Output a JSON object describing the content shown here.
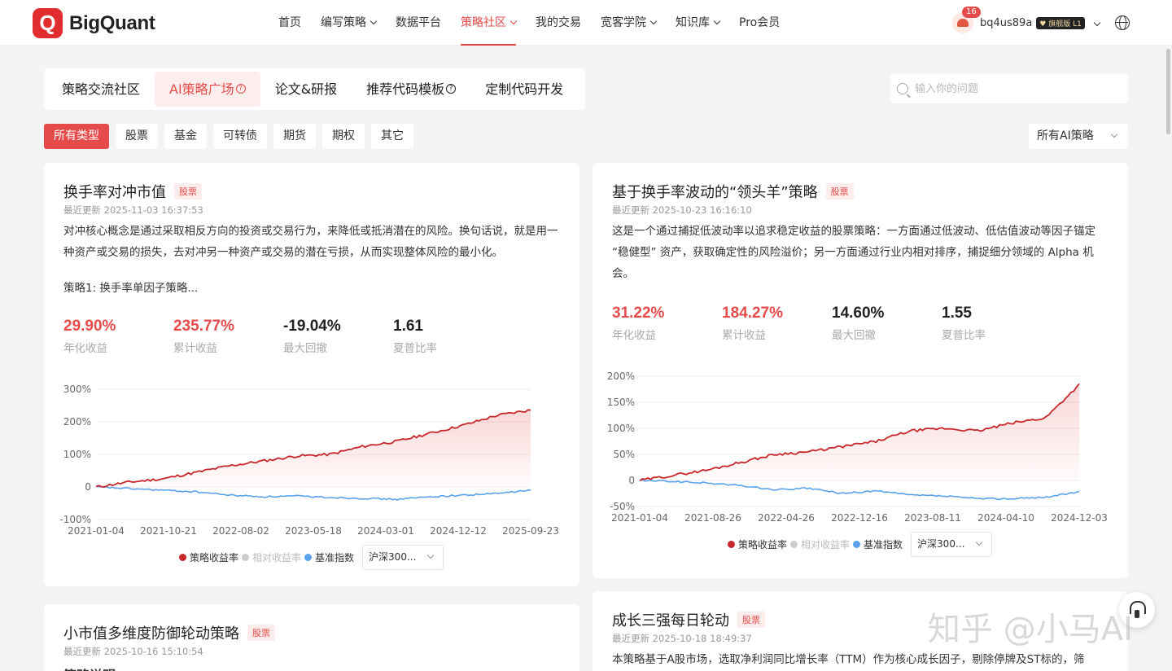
{
  "header": {
    "logo_text": "BigQuant",
    "logo_mark": "Q",
    "nav": [
      {
        "label": "首页",
        "dropdown": false,
        "active": false
      },
      {
        "label": "编写策略",
        "dropdown": true,
        "active": false
      },
      {
        "label": "数据平台",
        "dropdown": false,
        "active": false
      },
      {
        "label": "策略社区",
        "dropdown": true,
        "active": true
      },
      {
        "label": "我的交易",
        "dropdown": false,
        "active": false
      },
      {
        "label": "宽客学院",
        "dropdown": true,
        "active": false
      },
      {
        "label": "知识库",
        "dropdown": true,
        "active": false
      },
      {
        "label": "Pro会员",
        "dropdown": false,
        "active": false
      }
    ],
    "notification_count": "16",
    "username": "bq4us89a",
    "tier_badge": "旗舰版 L1",
    "language_icon": "globe-icon"
  },
  "subtabs": [
    {
      "label": "策略交流社区",
      "active": false,
      "help": false
    },
    {
      "label": "AI策略广场",
      "active": true,
      "help": true
    },
    {
      "label": "论文&研报",
      "active": false,
      "help": false
    },
    {
      "label": "推荐代码模板",
      "active": false,
      "help": true
    },
    {
      "label": "定制代码开发",
      "active": false,
      "help": false
    }
  ],
  "search": {
    "placeholder": "输入你的问题"
  },
  "filters": [
    "所有类型",
    "股票",
    "基金",
    "可转债",
    "期货",
    "期权",
    "其它"
  ],
  "active_filter": "所有类型",
  "strategy_select": "所有AI策略",
  "colors": {
    "accent": "#e54b4b",
    "strategy_line": "#c8272c",
    "benchmark_line": "#5aa3ec"
  },
  "cards": [
    {
      "title": "换手率对冲市值",
      "tag": "股票",
      "updated": "最近更新 2025-11-03 16:37:53",
      "desc": "对冲核心概念是通过采取相反方向的投资或交易行为，来降低或抵消潜在的风险。换句话说，就是用一种资产或交易的损失，去对冲另一种资产或交易的潜在亏损，从而实现整体风险的最小化。",
      "sub_desc": "策略1: 换手率单因子策略...",
      "metrics": [
        {
          "value": "29.90%",
          "label": "年化收益"
        },
        {
          "value": "235.77%",
          "label": "累计收益"
        },
        {
          "value": "-19.04%",
          "label": "最大回撤"
        },
        {
          "value": "1.61",
          "label": "夏普比率"
        }
      ],
      "legend": {
        "strategy": "策略收益率",
        "relative": "相对收益率",
        "benchmark": "基准指数",
        "index_select": "沪深300..."
      }
    },
    {
      "title": "基于换手率波动的“领头羊”策略",
      "tag": "股票",
      "updated": "最近更新 2025-10-23 16:16:10",
      "desc": "这是一个通过捕捉低波动率以追求稳定收益的股票策略：一方面通过低波动、低估值波动等因子锚定 “稳健型” 资产，获取确定性的风险溢价；另一方面通过行业内相对排序，捕捉细分领域的 Alpha 机会。",
      "metrics": [
        {
          "value": "31.22%",
          "label": "年化收益"
        },
        {
          "value": "184.27%",
          "label": "累计收益"
        },
        {
          "value": "14.60%",
          "label": "最大回撤"
        },
        {
          "value": "1.55",
          "label": "夏普比率"
        }
      ],
      "legend": {
        "strategy": "策略收益率",
        "relative": "相对收益率",
        "benchmark": "基准指数",
        "index_select": "沪深300..."
      }
    },
    {
      "title": "小市值多维度防御轮动策略",
      "tag": "股票",
      "updated": "最近更新 2025-10-16 15:10:54",
      "desc": "策略说明"
    },
    {
      "title": "成长三强每日轮动",
      "tag": "股票",
      "updated": "最近更新 2025-10-18 18:49:37",
      "desc": "本策略基于A股市场，选取净利润同比增长率（TTM）作为核心成长因子，剔除停牌及ST标的，筛"
    }
  ],
  "chart_data": [
    {
      "type": "line",
      "x_ticks": [
        "2021-01-04",
        "2021-10-21",
        "2022-08-02",
        "2023-05-18",
        "2024-03-01",
        "2024-12-12",
        "2025-09-23"
      ],
      "y_ticks": [
        "300%",
        "200%",
        "100%",
        "0",
        "-100%"
      ],
      "ylim": [
        -100,
        300
      ],
      "series": [
        {
          "name": "策略收益率",
          "values": [
            0,
            15,
            25,
            45,
            65,
            80,
            95,
            100,
            125,
            140,
            165,
            190,
            220,
            236
          ]
        },
        {
          "name": "基准指数",
          "values": [
            0,
            -5,
            -10,
            -15,
            -25,
            -30,
            -28,
            -32,
            -35,
            -38,
            -30,
            -25,
            -20,
            -10
          ]
        }
      ]
    },
    {
      "type": "line",
      "x_ticks": [
        "2021-01-04",
        "2021-08-26",
        "2022-04-26",
        "2022-12-16",
        "2023-08-11",
        "2024-04-10",
        "2024-12-03"
      ],
      "y_ticks": [
        "200%",
        "150%",
        "100%",
        "50%",
        "0",
        "-50%"
      ],
      "ylim": [
        -50,
        200
      ],
      "series": [
        {
          "name": "策略收益率",
          "values": [
            0,
            10,
            20,
            35,
            50,
            55,
            65,
            75,
            95,
            100,
            95,
            110,
            120,
            184
          ]
        },
        {
          "name": "基准指数",
          "values": [
            0,
            -2,
            -5,
            -10,
            -18,
            -15,
            -25,
            -20,
            -28,
            -30,
            -35,
            -35,
            -32,
            -22
          ]
        }
      ]
    }
  ],
  "watermark": "知乎 @小马AI"
}
